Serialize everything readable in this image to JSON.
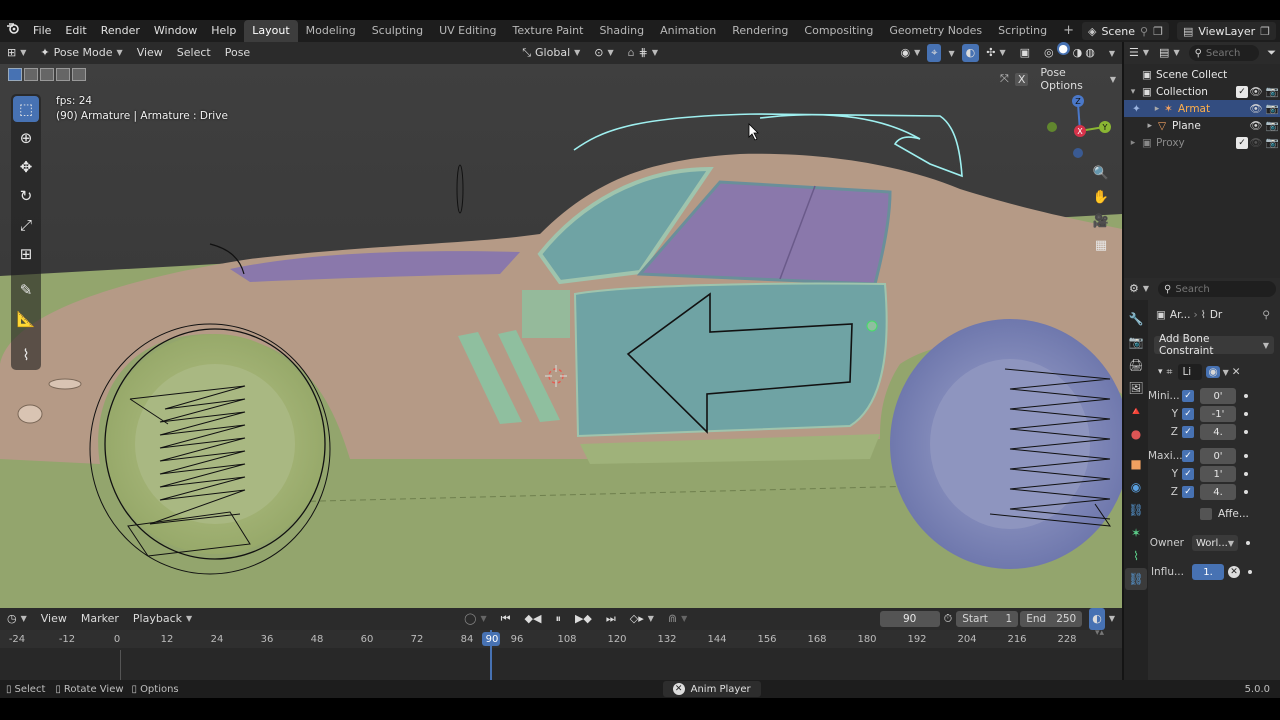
{
  "topbar": {
    "menus": [
      "File",
      "Edit",
      "Render",
      "Window",
      "Help"
    ],
    "workspaces": [
      "Layout",
      "Modeling",
      "Sculpting",
      "UV Editing",
      "Texture Paint",
      "Shading",
      "Animation",
      "Rendering",
      "Compositing",
      "Geometry Nodes",
      "Scripting"
    ],
    "active_workspace": "Layout",
    "add_tab": "+",
    "scene": "Scene",
    "view_layer": "ViewLayer"
  },
  "viewport_header": {
    "mode": "Pose Mode",
    "menus": [
      "View",
      "Select",
      "Pose"
    ],
    "transform_orientation": "Global",
    "pose_options": "Pose Options"
  },
  "overlay": {
    "fps": "fps: 24",
    "object_info": "(90) Armature | Armature : Drive"
  },
  "gizmo": {
    "z": "Z",
    "y": "Y",
    "x": "X"
  },
  "timeline": {
    "menus": [
      "View",
      "Marker",
      "Playback"
    ],
    "current_frame": "90",
    "start_label": "Start",
    "start_value": "1",
    "end_label": "End",
    "end_value": "250",
    "ticks": [
      "-24",
      "-12",
      "0",
      "12",
      "24",
      "36",
      "48",
      "60",
      "72",
      "84",
      "90",
      "96",
      "108",
      "120",
      "132",
      "144",
      "156",
      "168",
      "180",
      "192",
      "204",
      "216",
      "228"
    ]
  },
  "statusbar": {
    "select": "Select",
    "rotate_view": "Rotate View",
    "options": "Options",
    "anim_player": "Anim Player",
    "version": "5.0.0"
  },
  "outliner": {
    "search_placeholder": "Search",
    "items": [
      {
        "label": "Scene Collect"
      },
      {
        "label": "Collection"
      },
      {
        "label": "Armat"
      },
      {
        "label": "Plane"
      },
      {
        "label": "Proxy"
      }
    ]
  },
  "properties": {
    "search_placeholder": "Search",
    "object_name": "Ar...",
    "bone_name": "Dr",
    "add_constraint": "Add Bone Constraint",
    "constraint_name": "Li",
    "min_label": "Mini...",
    "max_label": "Maxi...",
    "y_label": "Y",
    "z_label": "Z",
    "min_x": "0'",
    "min_y": "-1'",
    "min_z": "4.",
    "max_x": "0'",
    "max_y": "1'",
    "max_z": "4.",
    "affect": "Affe...",
    "owner_label": "Owner",
    "owner_value": "Worl...",
    "influence_label": "Influ...",
    "influence_value": "1."
  },
  "colors": {
    "accent": "#4772b3",
    "selected_row": "#334d80",
    "car_body": "#b59a86",
    "car_green": "#9fb27a",
    "car_teal": "#6fa3a4",
    "car_purple": "#8a78ab",
    "wheel_blue": "#7d87b8",
    "ground": "#93a56d"
  }
}
